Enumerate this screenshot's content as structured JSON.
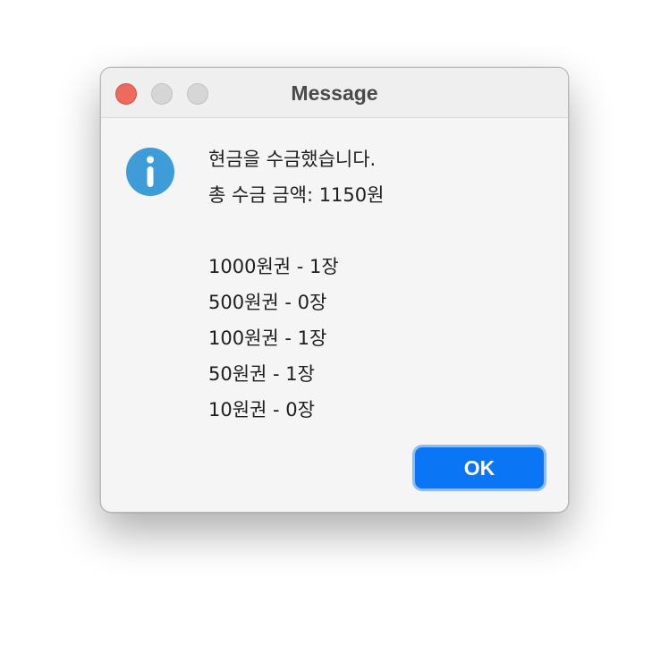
{
  "window": {
    "title": "Message"
  },
  "message": {
    "lines": [
      "현금을 수금했습니다.",
      "총 수금 금액: 1150원",
      "",
      "1000원권 - 1장",
      "500원권 - 0장",
      "100원권 - 1장",
      "50원권 - 1장",
      "10원권 - 0장"
    ]
  },
  "buttons": {
    "ok_label": "OK"
  },
  "icons": {
    "dialog_icon": "info-icon",
    "close": "close-icon",
    "minimize": "minimize-icon",
    "zoom": "zoom-icon"
  },
  "colors": {
    "accent": "#0a76f6",
    "info_icon": "#3e9dd8",
    "close_button": "#ec6a5e",
    "inactive_button": "#d6d6d6"
  }
}
